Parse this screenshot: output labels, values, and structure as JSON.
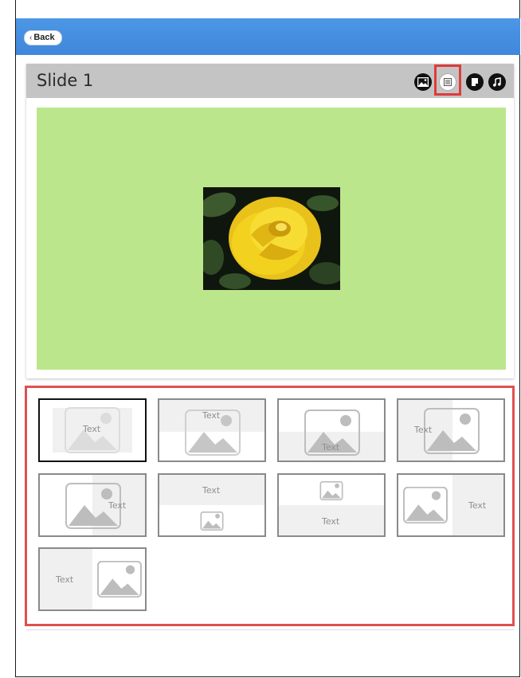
{
  "nav": {
    "back_label": "Back"
  },
  "slide": {
    "title": "Slide 1"
  },
  "toolbar": {
    "buttons": [
      {
        "icon": "image-icon",
        "state": "default"
      },
      {
        "icon": "layout-icon",
        "state": "active-highlighted"
      },
      {
        "icon": "text-icon",
        "state": "default"
      },
      {
        "icon": "music-icon",
        "state": "default"
      }
    ]
  },
  "canvas": {
    "background": "#bce68c",
    "image_subject": "yellow rose"
  },
  "highlight_color": "#e03a3a",
  "layouts": {
    "tiles": [
      {
        "text": "Text",
        "selected": true
      },
      {
        "text": "Text",
        "selected": false
      },
      {
        "text": "Text",
        "selected": false
      },
      {
        "text": "Text",
        "selected": false
      },
      {
        "text": "Text",
        "selected": false
      },
      {
        "text": "Text",
        "selected": false
      },
      {
        "text": "Text",
        "selected": false
      },
      {
        "text": "Text",
        "selected": false
      },
      {
        "text": "Text",
        "selected": false
      }
    ]
  }
}
